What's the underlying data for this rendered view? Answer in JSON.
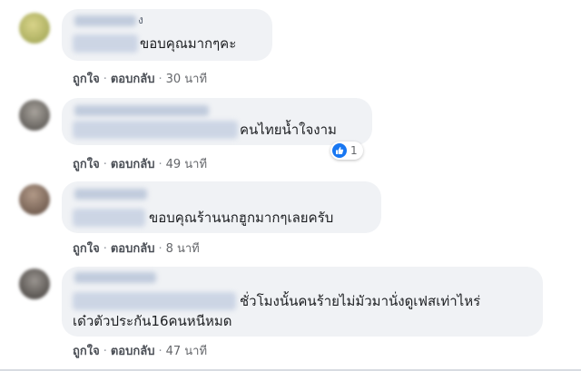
{
  "comments": [
    {
      "text": "ขอบคุณมากๆคะ",
      "name_fragment": "ง",
      "like_label": "ถูกใจ",
      "reply_label": "ตอบกลับ",
      "time": "30 นาที"
    },
    {
      "text": "คนไทยน้ำใจงาม",
      "like_label": "ถูกใจ",
      "reply_label": "ตอบกลับ",
      "time": "49 นาที",
      "reaction_count": "1"
    },
    {
      "text": "ขอบคุณร้านนกฮูกมากๆเลยครับ",
      "like_label": "ถูกใจ",
      "reply_label": "ตอบกลับ",
      "time": "8 นาที"
    },
    {
      "text_line1": "ชั่วโมงนั้นคนร้ายไม่มัวมานั่งดูเฟสเท่าไหร่",
      "text_line2": "เด๋วตัวประกัน16คนหนีหมด",
      "like_label": "ถูกใจ",
      "reply_label": "ตอบกลับ",
      "time": "47 นาที"
    }
  ],
  "separator": "·",
  "colors": {
    "link": "#4b4f56",
    "bubble": "#f0f2f5",
    "like_blue": "#1877f2"
  }
}
